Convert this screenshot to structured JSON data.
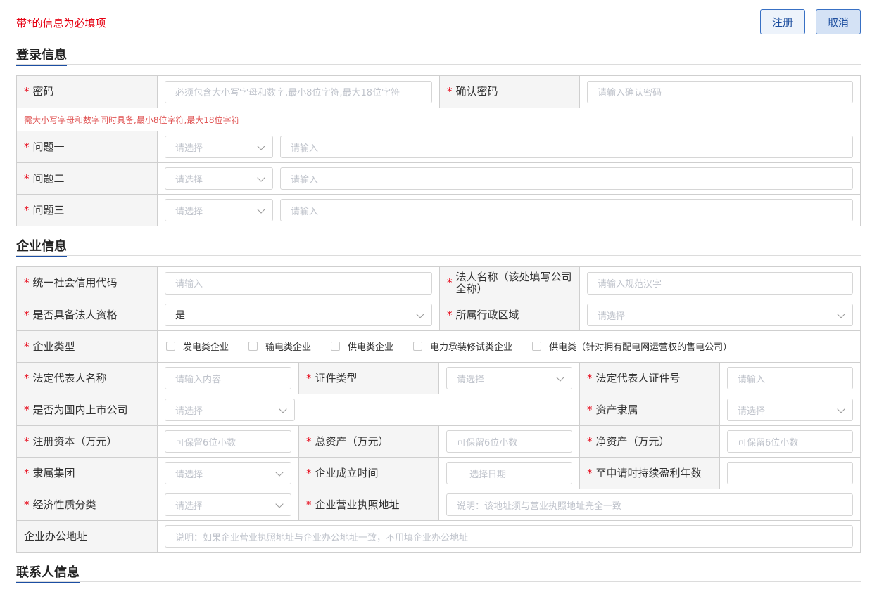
{
  "header": {
    "required_note": "带*的信息为必填项",
    "register_label": "注册",
    "cancel_label": "取消"
  },
  "login_section": {
    "title": "登录信息",
    "password_label": "密码",
    "password_placeholder": "必须包含大小写字母和数字,最小8位字符,最大18位字符",
    "confirm_label": "确认密码",
    "confirm_placeholder": "请输入确认密码",
    "hint": "需大小写字母和数字同时具备,最小8位字符,最大18位字符",
    "questions": [
      {
        "label": "问题一",
        "select_placeholder": "请选择",
        "input_placeholder": "请输入"
      },
      {
        "label": "问题二",
        "select_placeholder": "请选择",
        "input_placeholder": "请输入"
      },
      {
        "label": "问题三",
        "select_placeholder": "请选择",
        "input_placeholder": "请输入"
      }
    ]
  },
  "company_section": {
    "title": "企业信息",
    "credit_code_label": "统一社会信用代码",
    "credit_code_placeholder": "请输入",
    "legal_name_label": "法人名称（该处填写公司全称）",
    "legal_name_placeholder": "请输入规范汉字",
    "has_legal_label": "是否具备法人资格",
    "has_legal_value": "是",
    "region_label": "所属行政区域",
    "region_placeholder": "请选择",
    "type_label": "企业类型",
    "types": [
      "发电类企业",
      "输电类企业",
      "供电类企业",
      "电力承装修试类企业",
      "供电类（针对拥有配电网运营权的售电公司）"
    ],
    "rep_name_label": "法定代表人名称",
    "rep_name_placeholder": "请输入内容",
    "id_type_label": "证件类型",
    "id_type_placeholder": "请选择",
    "rep_id_label": "法定代表人证件号",
    "rep_id_placeholder": "请输入",
    "listed_label": "是否为国内上市公司",
    "listed_placeholder": "请选择",
    "asset_owner_label": "资产隶属",
    "asset_owner_placeholder": "请选择",
    "reg_capital_label": "注册资本（万元）",
    "reg_capital_placeholder": "可保留6位小数",
    "total_assets_label": "总资产（万元）",
    "total_assets_placeholder": "可保留6位小数",
    "net_assets_label": "净资产（万元）",
    "net_assets_placeholder": "可保留6位小数",
    "group_label": "隶属集团",
    "group_placeholder": "请选择",
    "founded_label": "企业成立时间",
    "founded_placeholder": "选择日期",
    "profit_years_label": "至申请时持续盈利年数",
    "profit_years_placeholder": "",
    "economy_label": "经济性质分类",
    "economy_placeholder": "请选择",
    "license_addr_label": "企业营业执照地址",
    "license_addr_placeholder": "说明：该地址须与营业执照地址完全一致",
    "office_addr_label": "企业办公地址",
    "office_addr_placeholder": "说明：如果企业营业执照地址与企业办公地址一致，不用填企业办公地址"
  },
  "contact_section": {
    "title": "联系人信息"
  }
}
